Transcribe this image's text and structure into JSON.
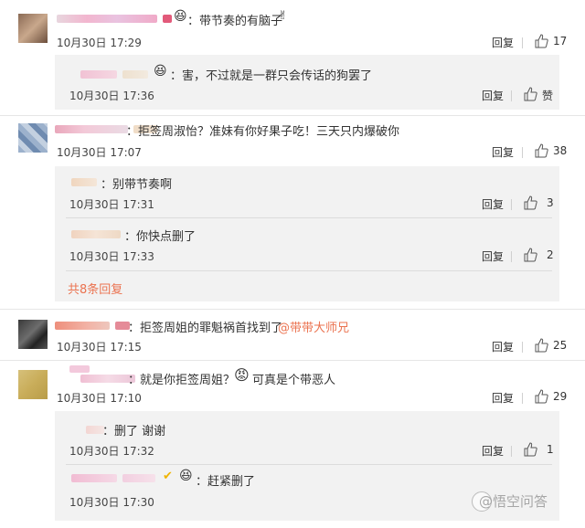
{
  "comments": [
    {
      "text": "：带节奏的有脑子",
      "time": "10月30日 17:29",
      "reply": "回复",
      "likes": "17"
    },
    {
      "text": "：拒签周淑怡？准妹有你好果子吃！三天只内爆破你",
      "time": "10月30日 17:07",
      "reply": "回复",
      "likes": "38"
    },
    {
      "text": "：拒签周姐的罪魁祸首找到了",
      "mention": "@带带大师兄",
      "time": "10月30日 17:15",
      "reply": "回复",
      "likes": "25"
    },
    {
      "text": "：就是你拒签周姐？",
      "text2": "可真是个带恶人",
      "time": "10月30日 17:10",
      "reply": "回复",
      "likes": "29"
    }
  ],
  "replies": [
    {
      "text": "：害，不过就是一群只会传话的狗罢了",
      "time": "10月30日 17:36",
      "reply": "回复",
      "likes": "赞"
    },
    {
      "text": "：别带节奏啊",
      "time": "10月30日 17:31",
      "reply": "回复",
      "likes": "3"
    },
    {
      "text": "：你快点删了",
      "time": "10月30日 17:33",
      "reply": "回复",
      "likes": "2"
    },
    {
      "text": "：删了 谢谢",
      "time": "10月30日 17:32",
      "reply": "回复",
      "likes": "1"
    },
    {
      "text": "：赶紧删了",
      "time": "10月30日 17:30",
      "reply": ""
    }
  ],
  "more_replies": "共8条回复",
  "watermark": "@悟空问答",
  "colors": {
    "link": "#eb7350",
    "panel": "#f2f2f2"
  }
}
